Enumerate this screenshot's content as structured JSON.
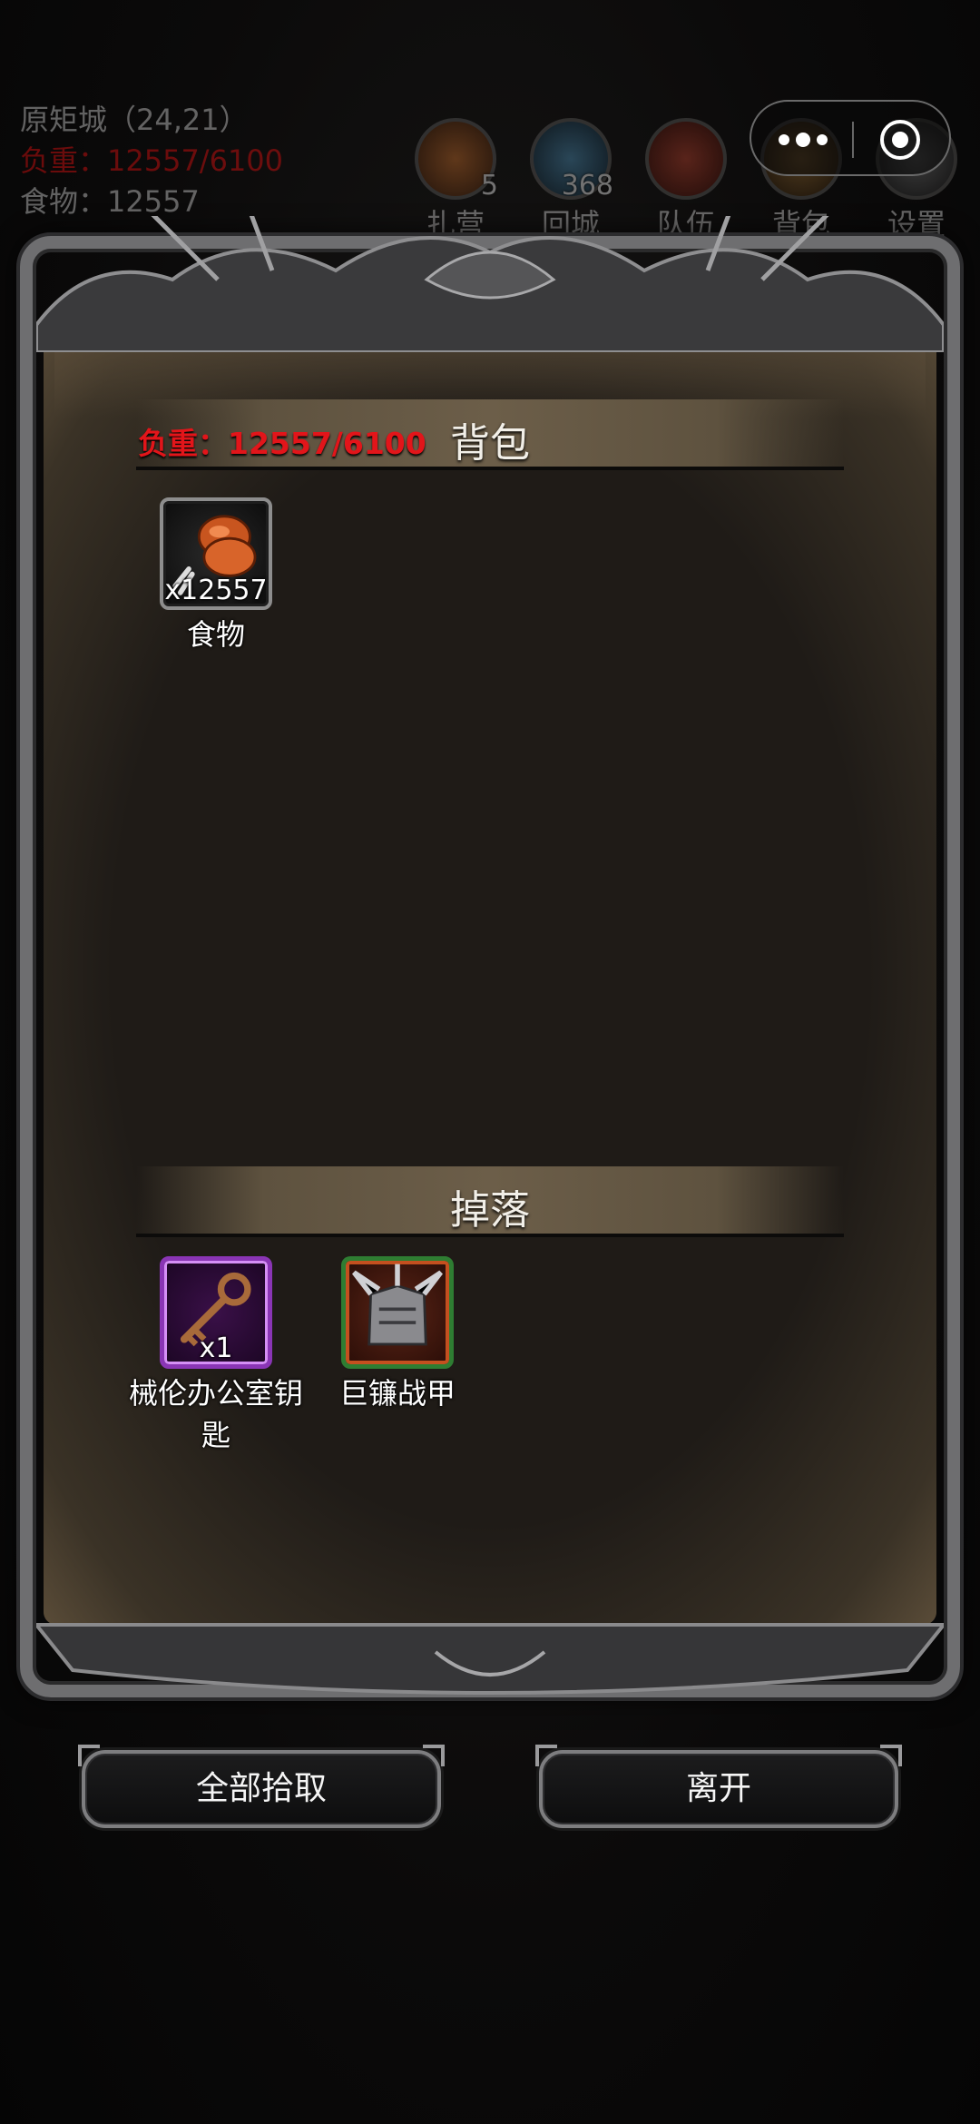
{
  "hud": {
    "location": "原矩城（24,21）",
    "weight": "负重：12557/6100",
    "food": "食物：12557",
    "buttons": [
      {
        "label": "扎营",
        "badge": "5",
        "icon": "campfire-icon",
        "color": "#8a4a1c"
      },
      {
        "label": "回城",
        "badge": "368",
        "icon": "portal-icon",
        "color": "#2a5a78"
      },
      {
        "label": "队伍",
        "badge": "",
        "icon": "team-icon",
        "color": "#7a2418"
      },
      {
        "label": "背包",
        "badge": "",
        "icon": "backpack-icon",
        "color": "#6a4a22"
      },
      {
        "label": "设置",
        "badge": "",
        "icon": "settings-icon",
        "color": "#4a4a4a"
      }
    ]
  },
  "backpack": {
    "title": "背包",
    "weight_label": "负重：12557/6100",
    "items": [
      {
        "name": "食物",
        "qty": "x12557",
        "icon": "meat-drumstick-icon"
      }
    ]
  },
  "drops": {
    "title": "掉落",
    "items": [
      {
        "name": "械伦办公室钥匙",
        "qty": "x1",
        "icon": "key-icon",
        "rarity_color": "#8a35b5"
      },
      {
        "name": "巨镰战甲",
        "qty": "",
        "icon": "spiked-armor-icon",
        "rarity_color": "#2e7d32"
      }
    ]
  },
  "actions": {
    "pick_all": "全部拾取",
    "leave": "离开"
  },
  "colors": {
    "weight_warning": "#e2151a",
    "panel_parchment": "#5e523f"
  }
}
